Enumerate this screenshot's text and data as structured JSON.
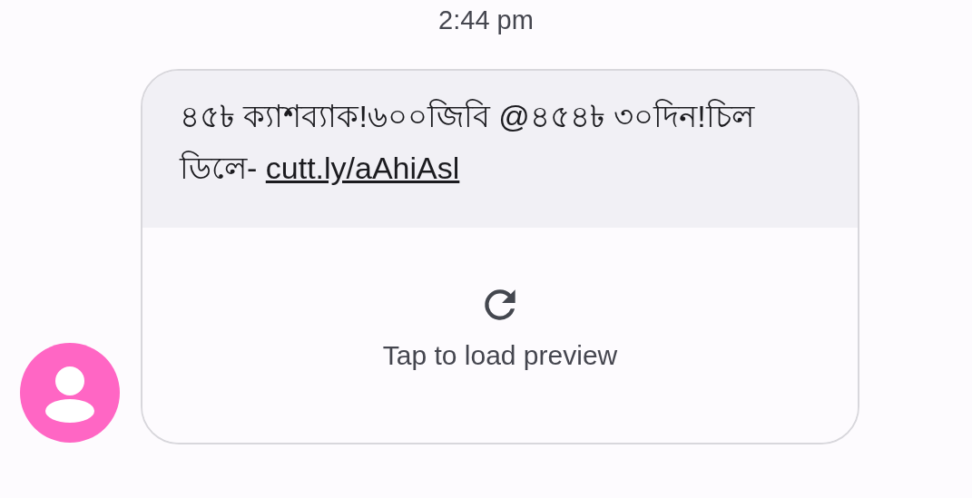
{
  "timestamp": "2:44 pm",
  "message": {
    "text": "৪৫৳ ক্যাশব্যাক!৬০০জিবি @৪৫৪৳ ৩০দিন!চিল ডিলে- ",
    "link": "cutt.ly/aAhiAsl"
  },
  "preview": {
    "label": "Tap to load preview"
  }
}
